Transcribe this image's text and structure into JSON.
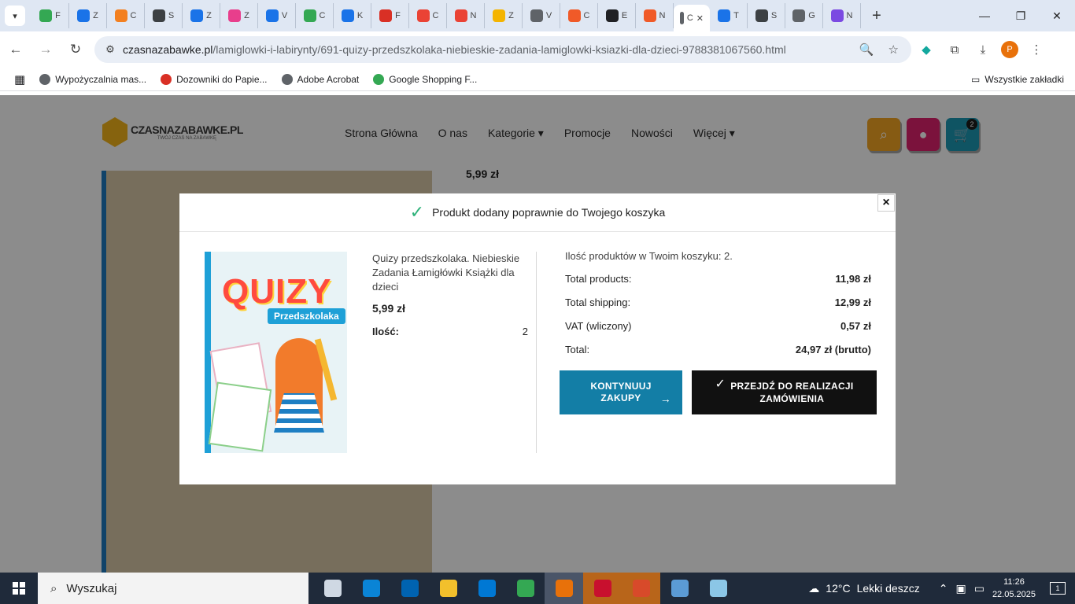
{
  "browser": {
    "tabs": [
      {
        "letter": "F",
        "color": "#34a853"
      },
      {
        "letter": "Z",
        "color": "#1a73e8"
      },
      {
        "letter": "C",
        "color": "#f38020"
      },
      {
        "letter": "S",
        "color": "#3c4043"
      },
      {
        "letter": "Z",
        "color": "#1a73e8"
      },
      {
        "letter": "Z",
        "color": "#e83e8c"
      },
      {
        "letter": "V",
        "color": "#1a73e8"
      },
      {
        "letter": "C",
        "color": "#34a853"
      },
      {
        "letter": "K",
        "color": "#1a73e8"
      },
      {
        "letter": "F",
        "color": "#d93025"
      },
      {
        "letter": "C",
        "color": "#ea4335"
      },
      {
        "letter": "N",
        "color": "#ea4335"
      },
      {
        "letter": "Z",
        "color": "#f4b400"
      },
      {
        "letter": "V",
        "color": "#5f6368"
      },
      {
        "letter": "C",
        "color": "#f05a28"
      },
      {
        "letter": "E",
        "color": "#202124"
      },
      {
        "letter": "N",
        "color": "#f05a28"
      },
      {
        "letter": "C",
        "color": "#5f6368"
      },
      {
        "letter": "T",
        "color": "#1a73e8"
      },
      {
        "letter": "S",
        "color": "#3c4043"
      },
      {
        "letter": "G",
        "color": "#5f6368"
      },
      {
        "letter": "N",
        "color": "#7b4ae2"
      }
    ],
    "active_tab_index": 17,
    "close_tab": "✕",
    "new_tab": "+",
    "url_host": "czasnazabawke.pl",
    "url_path": "/lamiglowki-i-labirynty/691-quizy-przedszkolaka-niebieskie-zadania-lamiglowki-ksiazki-dla-dzieci-9788381067560.html",
    "profile_letter": "P",
    "bookmarks": [
      {
        "label": "Wypożyczalnia mas...",
        "color": "#5f6368"
      },
      {
        "label": "Dozowniki do Papie...",
        "color": "#d93025"
      },
      {
        "label": "Adobe Acrobat",
        "color": "#5f6368"
      },
      {
        "label": "Google Shopping F...",
        "color": "#34a853"
      }
    ],
    "all_bookmarks": "Wszystkie zakładki"
  },
  "site": {
    "logo_text": "CZASNAZABAWKE.PL",
    "logo_tagline": "TWÓJ CZAS NA ZABAWKĘ",
    "nav": [
      "Strona Główna",
      "O nas",
      "Kategorie ▾",
      "Promocje",
      "Nowości",
      "Więcej ▾"
    ],
    "cart_count": "2",
    "price_behind": "5,99 zł",
    "colors": {
      "search": "#f5a623",
      "account": "#e0226e",
      "cart": "#1c9ab5"
    }
  },
  "modal": {
    "header": "Produkt dodany poprawnie do Twojego koszyka",
    "close": "×",
    "cover_title": "QUIZY",
    "cover_subtitle": "Przedszkolaka",
    "product_name": "Quizy przedszkolaka. Niebieskie Zadania Łamigłówki Książki dla dzieci",
    "product_price": "5,99 zł",
    "qty_label": "Ilość:",
    "qty_value": "2",
    "cart_count_text": "Ilość produktów w Twoim koszyku: 2.",
    "summary": [
      {
        "label": "Total products:",
        "value": "11,98 zł"
      },
      {
        "label": "Total shipping:",
        "value": "12,99 zł"
      },
      {
        "label": "VAT (wliczony)",
        "value": "0,57 zł"
      },
      {
        "label": "Total:",
        "value": "24,97 zł (brutto)"
      }
    ],
    "continue_line1": "KONTYNUUJ",
    "continue_line2": "ZAKUPY",
    "checkout_line1": "PRZEJDŹ DO REALIZACJI",
    "checkout_line2": "ZAMÓWIENIA"
  },
  "taskbar": {
    "search_placeholder": "Wyszukaj",
    "weather_temp": "12°C",
    "weather_desc": "Lekki deszcz",
    "time": "11:26",
    "date": "22.05.2025",
    "notifications": "1",
    "apps": [
      "#cfd8e3",
      "#0a84d6",
      "#0063b1",
      "#f2c02c",
      "#0078d4",
      "#34a853",
      "#e8710a",
      "#c8102e",
      "#d84a2a",
      "#5b9bd5",
      "#8bc6e6"
    ]
  }
}
